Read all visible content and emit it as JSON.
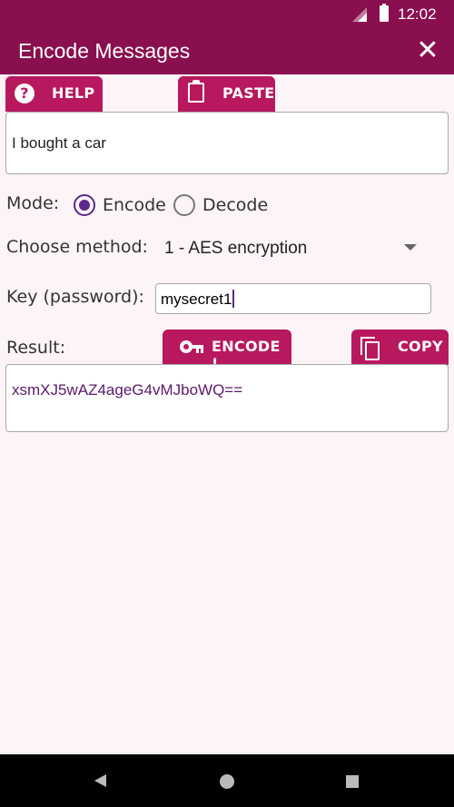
{
  "status_bar": {
    "time": "12:02"
  },
  "app_bar": {
    "title": "Encode Messages",
    "close_icon": "close-icon"
  },
  "toolbar": {
    "help_label": "HELP",
    "paste_label": "PASTE"
  },
  "message": {
    "value": "I bought a car"
  },
  "mode": {
    "label": "Mode:",
    "options": [
      "Encode",
      "Decode"
    ],
    "selected": "Encode"
  },
  "method": {
    "label": "Choose method:",
    "selected": "1 - AES encryption"
  },
  "key": {
    "label": "Key (password):",
    "value": "mysecret1"
  },
  "result": {
    "label": "Result:",
    "encode_label": "ENCODE !",
    "copy_label": "COPY",
    "value": "xsmXJ5wAZ4ageG4vMJboWQ=="
  },
  "colors": {
    "primary": "#8a0f4f",
    "accent": "#b8185e",
    "radio": "#5b2a8a",
    "background": "#fdf4f7"
  },
  "icons": [
    "signal-icon",
    "battery-icon",
    "close-icon",
    "help-icon",
    "clipboard-icon",
    "key-icon",
    "copy-icon",
    "dropdown-arrow-icon",
    "nav-back-icon",
    "nav-home-icon",
    "nav-recents-icon"
  ]
}
